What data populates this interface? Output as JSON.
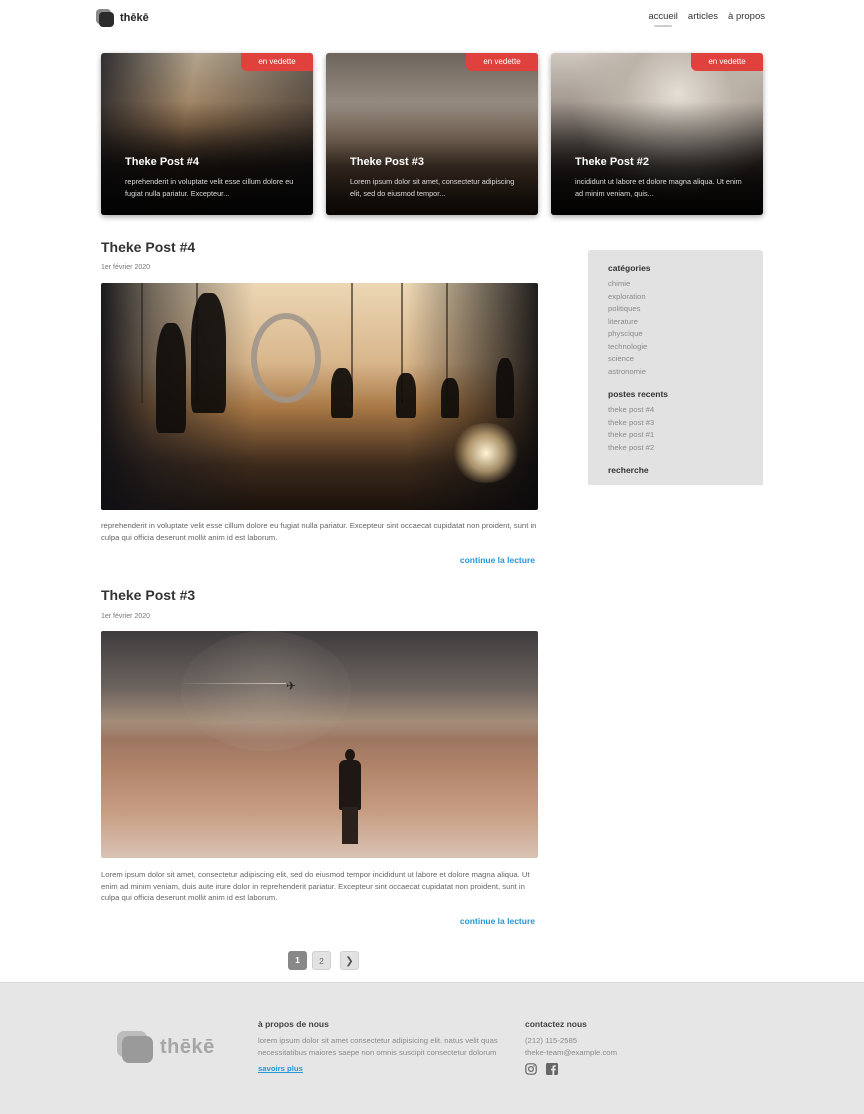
{
  "site": {
    "logo_text": "thēkē"
  },
  "nav": {
    "items": [
      "accueil",
      "articles",
      "à propos"
    ]
  },
  "featured": [
    {
      "badge": "en vedette",
      "title": "Theke Post #4",
      "excerpt": "reprehenderit in voluptate velit esse cillum dolore eu fugiat nulla pariatur. Excepteur..."
    },
    {
      "badge": "en vedette",
      "title": "Theke Post #3",
      "excerpt": "Lorem ipsum dolor sit amet, consectetur adipiscing elit, sed do eiusmod tempor..."
    },
    {
      "badge": "en vedette",
      "title": "Theke Post #2",
      "excerpt": "incididunt ut labore et dolore magna aliqua. Ut enim ad minim veniam, quis..."
    }
  ],
  "posts": [
    {
      "title": "Theke Post #4",
      "date": "1er février 2020",
      "excerpt": "reprehenderit in voluptate velit esse cillum dolore eu fugiat nulla pariatur. Excepteur sint occaecat cupidatat non proident, sunt in culpa qui officia deserunt mollit anim id est laborum.",
      "read_more": "continue la lecture"
    },
    {
      "title": "Theke Post #3",
      "date": "1er février 2020",
      "excerpt": "Lorem ipsum dolor sit amet, consectetur adipiscing elit, sed do eiusmod tempor incididunt ut labore et dolore magna aliqua. Ut enim ad minim veniam, duis aute irure dolor in reprehenderit pariatur. Excepteur sint occaecat cupidatat non proident, sunt in culpa qui officia deserunt mollit anim id est laborum.",
      "read_more": "continue la lecture"
    }
  ],
  "sidebar": {
    "categories_heading": "catégories",
    "categories": [
      "chimie",
      "exploration",
      "politiques",
      "literature",
      "physcique",
      "technologie",
      "science",
      "astronomie"
    ],
    "recent_heading": "postes recents",
    "recent": [
      "theke post #4",
      "theke post #3",
      "theke post #1",
      "theke post #2"
    ],
    "search_heading": "recherche"
  },
  "pagination": {
    "pages": [
      "1",
      "2"
    ],
    "next": "❯"
  },
  "footer": {
    "logo_text": "thēkē",
    "about_heading": "à propos de nous",
    "about_text": "lorem ipsum dolor sit amet consectetur adipisicing elit. natus velit quas necessitatibus maiores saepe non omnis suscipit consectetur dolorum",
    "about_link": "savoirs plus",
    "contact_heading": "contactez nous",
    "phone": "(212) 115-2585",
    "email": "theke-team@example.com",
    "social_icons": [
      "instagram-icon",
      "facebook-icon"
    ]
  },
  "colors": {
    "badge": "#e0413d",
    "link": "#2596d8",
    "sidebar_bg": "#e2e2e2",
    "footer_bg": "#e6e6e6"
  }
}
